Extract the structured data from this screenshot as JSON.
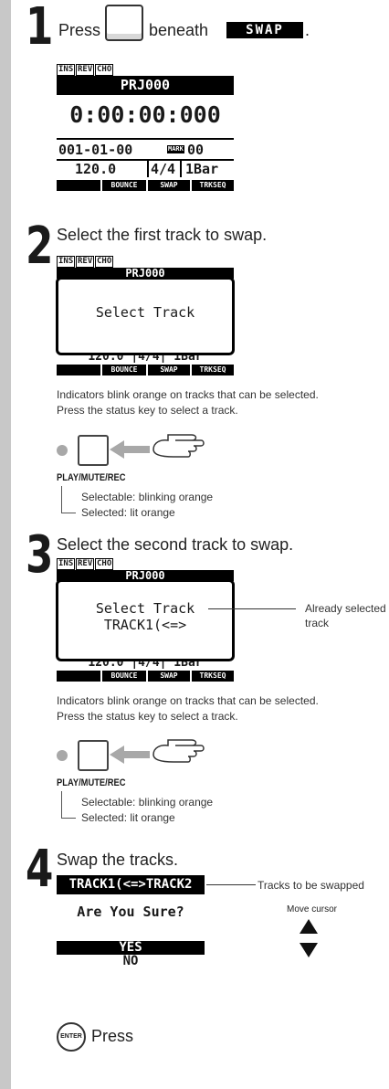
{
  "step1": {
    "number": "1",
    "press": "Press",
    "beneath": "beneath",
    "swap_badge": "SWAP",
    "lcd": {
      "flags": [
        "INS",
        "REV",
        "CHO"
      ],
      "project": "PRJ000",
      "time": "0:00:00:000",
      "position": "001-01-00",
      "mark_label": "MARK",
      "mark_value": "00",
      "tempo": "120.0",
      "signature": "4/4",
      "bars": "1Bar",
      "softkeys": [
        "",
        "BOUNCE",
        "SWAP",
        "TRKSEQ"
      ]
    }
  },
  "step2": {
    "number": "2",
    "title": "Select the first track to swap.",
    "lcd": {
      "flags": [
        "INS",
        "REV",
        "CHO"
      ],
      "project_partial": "PRJ000",
      "popup": "Select Track",
      "bottom_row": "120.0 |4/4| 1Bar",
      "softkeys": [
        "",
        "BOUNCE",
        "SWAP",
        "TRKSEQ"
      ]
    },
    "note1": "Indicators blink orange on tracks that can be selected.",
    "note2": "Press the status key to select a track.",
    "key_label": "PLAY/MUTE/REC",
    "selectable": "Selectable: blinking orange",
    "selected": "Selected: lit orange"
  },
  "step3": {
    "number": "3",
    "title": "Select the second track to swap.",
    "lcd": {
      "flags": [
        "INS",
        "REV",
        "CHO"
      ],
      "project_partial": "PRJ000",
      "popup_line1": "Select Track",
      "popup_line2": "TRACK1(<=>",
      "bottom_row": "120.0 |4/4| 1Bar",
      "softkeys": [
        "",
        "BOUNCE",
        "SWAP",
        "TRKSEQ"
      ]
    },
    "annotation": "Already selected track",
    "note1": "Indicators blink orange on tracks that can be selected.",
    "note2": "Press the status key to select a track.",
    "key_label": "PLAY/MUTE/REC",
    "selectable": "Selectable: blinking orange",
    "selected": "Selected: lit orange"
  },
  "step4": {
    "number": "4",
    "title": "Swap the tracks.",
    "track_line": "TRACK1(<=>TRACK2",
    "annotation": "Tracks to be swapped",
    "question": "Are You Sure?",
    "move_cursor": "Move cursor",
    "yes": "YES",
    "no": "NO",
    "enter_key": "ENTER",
    "press": "Press"
  },
  "colors": {
    "sidebar": "#c8c8c8",
    "led": "#a8a8a8",
    "lcd_ink": "#000000"
  }
}
